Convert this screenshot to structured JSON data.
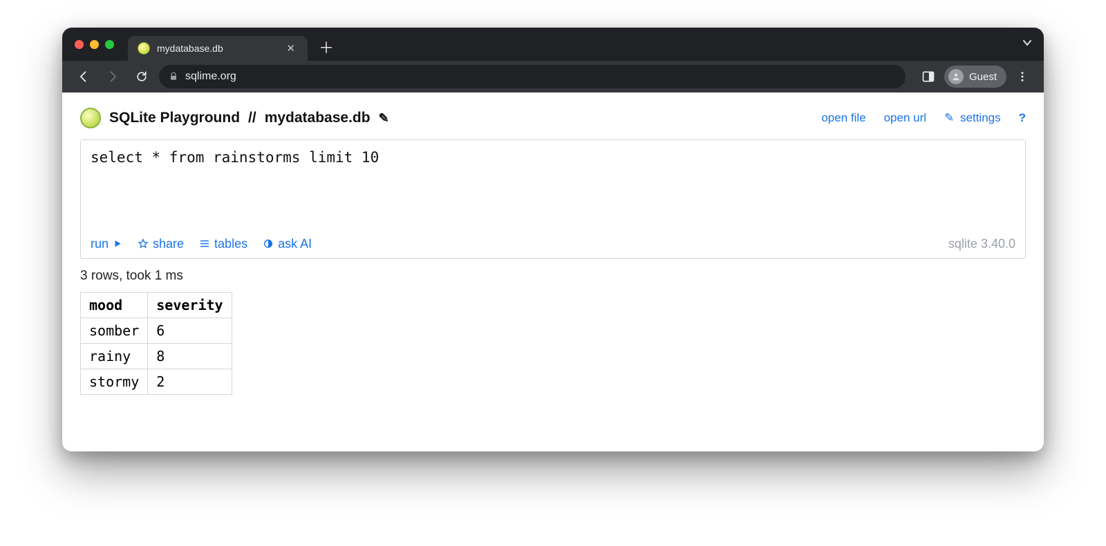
{
  "browser": {
    "tab_title": "mydatabase.db",
    "url": "sqlime.org",
    "guest_label": "Guest"
  },
  "header": {
    "app_name": "SQLite Playground",
    "separator": "//",
    "db_name": "mydatabase.db",
    "edit_icon": "✎",
    "links": {
      "open_file": "open file",
      "open_url": "open url",
      "settings_icon": "✎",
      "settings": "settings",
      "help": "?"
    }
  },
  "editor": {
    "sql": "select * from rainstorms limit 10",
    "toolbar": {
      "run": "run",
      "share": "share",
      "tables": "tables",
      "ask_ai": "ask AI"
    },
    "engine": "sqlite 3.40.0"
  },
  "status": "3 rows, took 1 ms",
  "results": {
    "columns": [
      "mood",
      "severity"
    ],
    "rows": [
      [
        "somber",
        "6"
      ],
      [
        "rainy",
        "8"
      ],
      [
        "stormy",
        "2"
      ]
    ]
  }
}
